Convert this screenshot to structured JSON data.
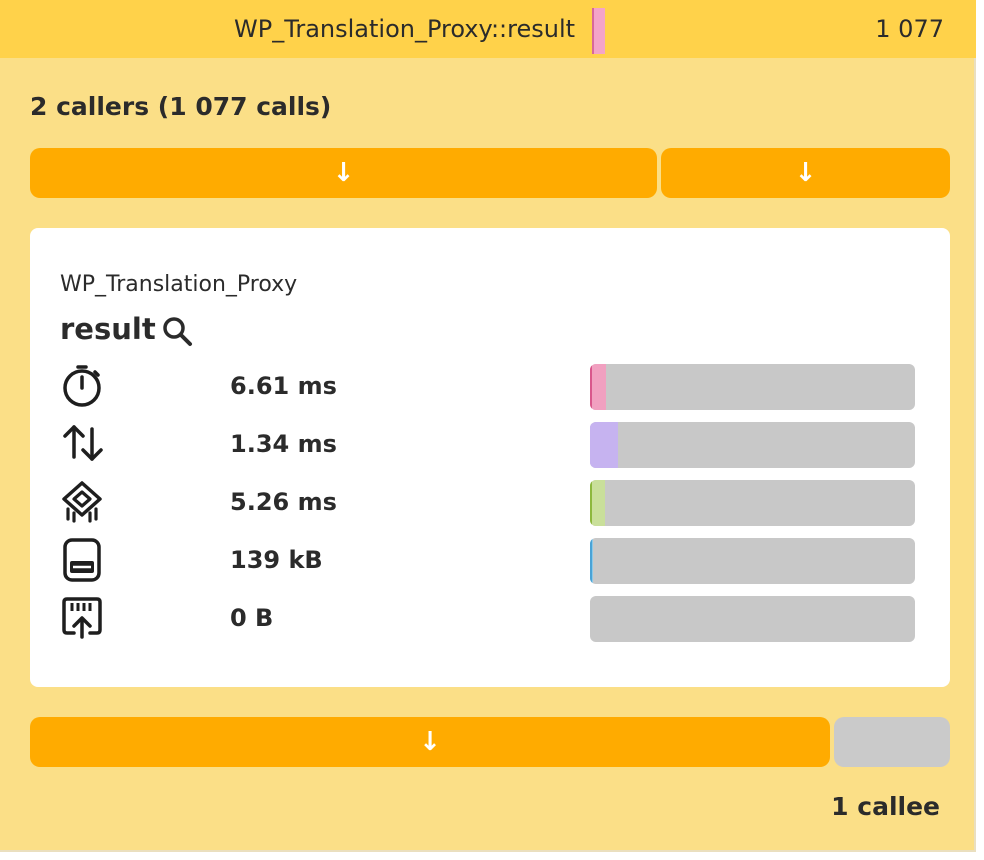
{
  "header": {
    "function_title": "WP_Translation_Proxy::result",
    "call_count": "1 077",
    "marker_color": "#f4a4c8"
  },
  "callers": {
    "title": "2 callers (1 077 calls)",
    "buttons": [
      {
        "label": "↓",
        "share": 0.68
      },
      {
        "label": "↓",
        "share": 0.32
      }
    ]
  },
  "detail": {
    "class_name": "WP_Translation_Proxy",
    "method_name": "result",
    "search_icon": "search-icon",
    "metrics": [
      {
        "name": "wall-time",
        "icon": "stopwatch-icon",
        "value": "6.61 ms",
        "fill": 0.05,
        "color": "#f1a0c0",
        "edge": "#d9578c"
      },
      {
        "name": "io-time",
        "icon": "io-arrows-icon",
        "value": "1.34 ms",
        "fill": 0.085,
        "color": "#c6b3f0",
        "edge": "#c6b3f0"
      },
      {
        "name": "cpu-time",
        "icon": "cpu-icon",
        "value": "5.26 ms",
        "fill": 0.045,
        "color": "#c9df9a",
        "edge": "#8db83e"
      },
      {
        "name": "memory",
        "icon": "memory-icon",
        "value": "139 kB",
        "fill": 0.008,
        "color": "#8cc9e8",
        "edge": "#4aa3d6"
      },
      {
        "name": "network",
        "icon": "network-icon",
        "value": "0 B",
        "fill": 0,
        "color": "#c8c8c8",
        "edge": "#c8c8c8"
      }
    ]
  },
  "callees": {
    "buttons": [
      {
        "label": "↓",
        "share": 0.87,
        "color": "#ffab00"
      },
      {
        "label": "",
        "share": 0.13,
        "color": "#cacaca"
      }
    ],
    "title": "1 callee"
  }
}
